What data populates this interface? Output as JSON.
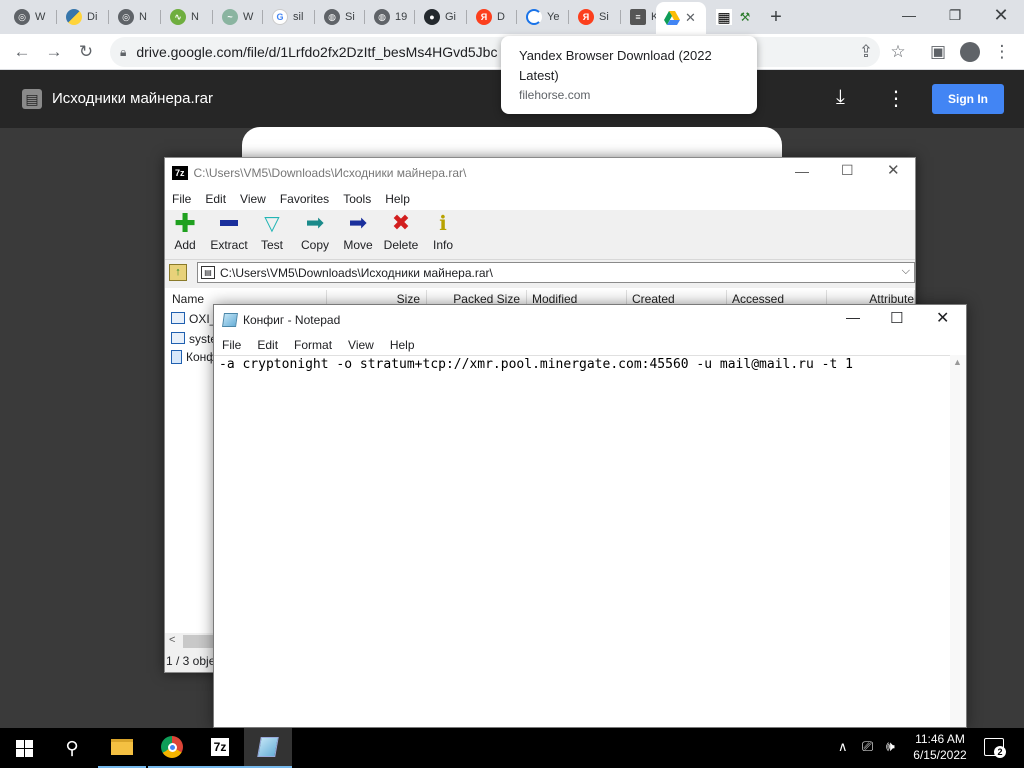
{
  "browser": {
    "tabs": [
      {
        "label": "W",
        "icon": "chrome-icon"
      },
      {
        "label": "Di",
        "icon": "python-icon"
      },
      {
        "label": "N",
        "icon": "chrome-icon"
      },
      {
        "label": "N",
        "icon": "site-icon"
      },
      {
        "label": "W",
        "icon": "site-icon"
      },
      {
        "label": "sil",
        "icon": "google-icon"
      },
      {
        "label": "Si",
        "icon": "globe-icon"
      },
      {
        "label": "19",
        "icon": "globe-icon"
      },
      {
        "label": "Gi",
        "icon": "github-icon"
      },
      {
        "label": "D",
        "icon": "yandex-icon"
      },
      {
        "label": "Ye",
        "icon": "loading-icon"
      },
      {
        "label": "Si",
        "icon": "yandex-icon"
      },
      {
        "label": "K",
        "icon": "db-icon"
      },
      {
        "label": "",
        "icon": "drive-icon"
      },
      {
        "label": "",
        "icon": "qr-icon"
      }
    ],
    "url": "drive.google.com/file/d/1Lrfdo2fx2DzItf_besMs4HGvd5Jbc",
    "popup": {
      "title": "Yandex Browser Download (2022 Latest)",
      "domain": "filehorse.com"
    }
  },
  "drive": {
    "filename": "Исходники майнера.rar",
    "signin": "Sign In"
  },
  "sevenzip": {
    "title": "C:\\Users\\VM5\\Downloads\\Исходники майнера.rar\\",
    "menu": [
      "File",
      "Edit",
      "View",
      "Favorites",
      "Tools",
      "Help"
    ],
    "buttons": [
      "Add",
      "Extract",
      "Test",
      "Copy",
      "Move",
      "Delete",
      "Info"
    ],
    "path": "C:\\Users\\VM5\\Downloads\\Исходники майнера.rar\\",
    "columns": [
      "Name",
      "Size",
      "Packed Size",
      "Modified",
      "Created",
      "Accessed",
      "Attribute"
    ],
    "rows": [
      "OXI_",
      "syste",
      "Конф"
    ],
    "status": "1 / 3 obje"
  },
  "notepad": {
    "title": "Конфиг - Notepad",
    "menu": [
      "File",
      "Edit",
      "Format",
      "View",
      "Help"
    ],
    "content": "-a cryptonight -o stratum+tcp://xmr.pool.minergate.com:45560 -u mail@mail.ru -t 1"
  },
  "taskbar": {
    "time": "11:46 AM",
    "date": "6/15/2022",
    "notifications": "2"
  }
}
